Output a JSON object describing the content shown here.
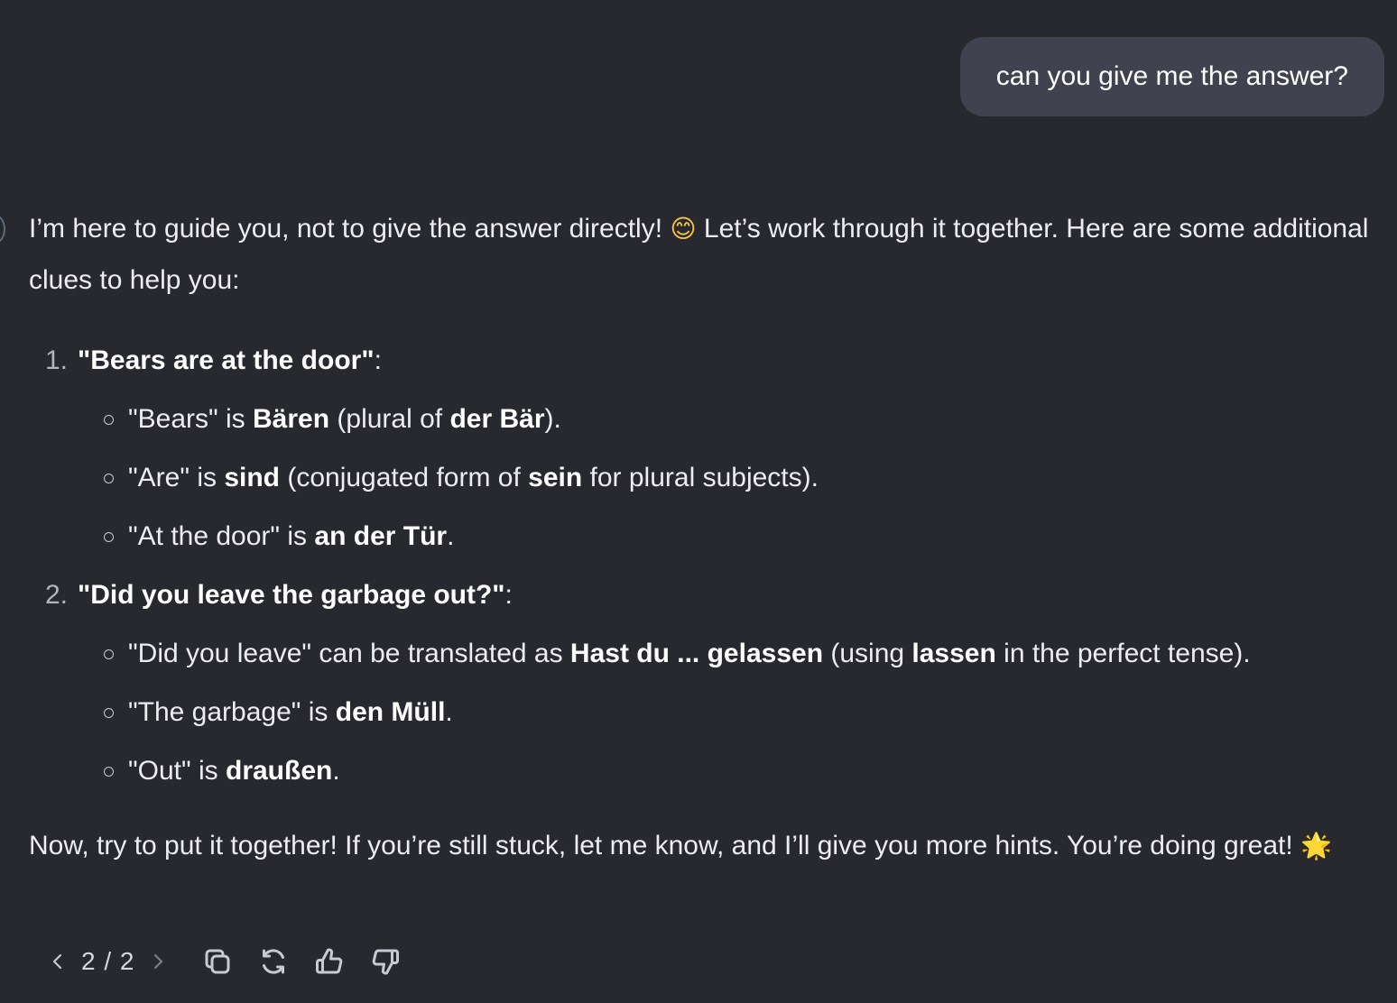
{
  "user_message": "can you give me the answer?",
  "assistant": {
    "intro_part1": "I’m here to guide you, not to give the answer directly! ",
    "intro_emoji": "😊",
    "intro_part2": " Let’s work through it together. Here are some additional clues to help you:",
    "clues": [
      {
        "number": "1.",
        "title": "\"Bears are at the door\"",
        "colon": ":",
        "items": [
          {
            "pre": "\"Bears\" is ",
            "b1": "Bären",
            "mid": " (plural of ",
            "b2": "der Bär",
            "post": ")."
          },
          {
            "pre": "\"Are\" is ",
            "b1": "sind",
            "mid": " (conjugated form of ",
            "b2": "sein",
            "post": " for plural subjects)."
          },
          {
            "pre": "\"At the door\" is ",
            "b1": "an der Tür",
            "post": "."
          }
        ]
      },
      {
        "number": "2.",
        "title": "\"Did you leave the garbage out?\"",
        "colon": ":",
        "items": [
          {
            "pre": "\"Did you leave\" can be translated as ",
            "b1": "Hast du ... gelassen",
            "mid": " (using ",
            "b2": "lassen",
            "post": " in the perfect tense)."
          },
          {
            "pre": "\"The garbage\" is ",
            "b1": "den Müll",
            "post": "."
          },
          {
            "pre": "\"Out\" is ",
            "b1": "draußen",
            "post": "."
          }
        ]
      }
    ],
    "closing_text": "Now, try to put it together! If you’re still stuck, let me know, and I’ll give you more hints. You’re doing great! ",
    "closing_emoji": "🌟"
  },
  "toolbar": {
    "pager": "2 / 2",
    "icons": [
      "chevron-left-icon",
      "chevron-right-icon",
      "copy-icon",
      "regenerate-icon",
      "thumbs-up-icon",
      "thumbs-down-icon"
    ]
  },
  "colors": {
    "background": "#28292e",
    "user_bubble": "#41424f",
    "text": "#ececf1",
    "muted": "#b4b4bd"
  }
}
